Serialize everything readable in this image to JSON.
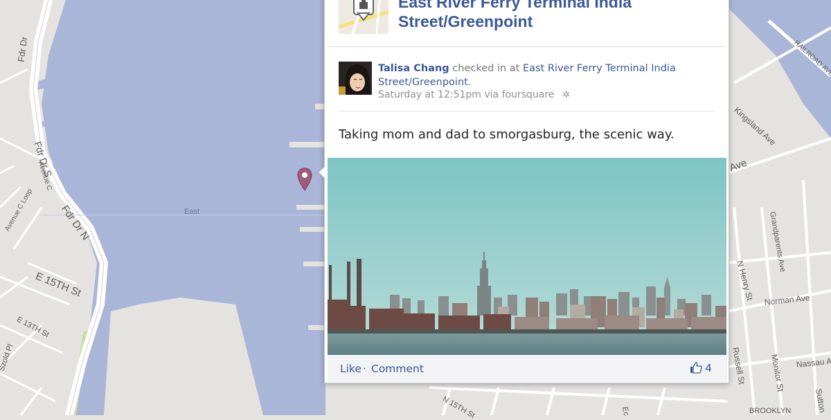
{
  "map": {
    "colors": {
      "water": "#aab6d8",
      "land": "#e5e3df",
      "road": "#ffffff",
      "park": "#c9dfa8"
    },
    "labels": {
      "fdr_dr_top": "Fdr Dr",
      "fdr_dr_s": "Fdr Dr S",
      "fdr_dr_n": "Fdr Dr N",
      "avenue_c": "Avenue C",
      "avenue_c_loop": "Avenue C Loop",
      "e_15th": "E 15TH St",
      "e_13th": "E 13TH St",
      "szold_pl": "Szold Pl",
      "east_river": "East",
      "railroad_ave": "RAILROAD AVE",
      "kingsland_ave": "Kingsland Ave",
      "ave_fragment": "Ave",
      "grandparents_ave": "Grandparents Ave",
      "n_henry_st": "N Henry St",
      "norman_ave": "Norman Ave",
      "russell_st": "Russell St",
      "monitor_st": "Monitor St",
      "nassau_ave": "Nassau Ave",
      "sutton_st": "Sutton",
      "n_15th_st": "N 15TH St",
      "eckford_fragment": "Ec",
      "brooklyn": "BROOKLYN"
    }
  },
  "popup": {
    "place_title": "East River Ferry Terminal India Street/Greenpoint",
    "author_name": "Talisa Chang",
    "checkin_text": " checked in at ",
    "place_link": "East River Ferry Terminal India Street/Greenpoint",
    "period": ".",
    "timestamp": "Saturday at 12:51pm via foursquare",
    "message": "Taking mom and dad to smorgasburg, the scenic way.",
    "actions": {
      "like_label": "Like",
      "separator": " · ",
      "comment_label": "Comment"
    },
    "like_count": "4",
    "colors": {
      "link": "#3b5998",
      "meta": "#8e8e8e",
      "action_bar": "#f2f3f5"
    }
  }
}
